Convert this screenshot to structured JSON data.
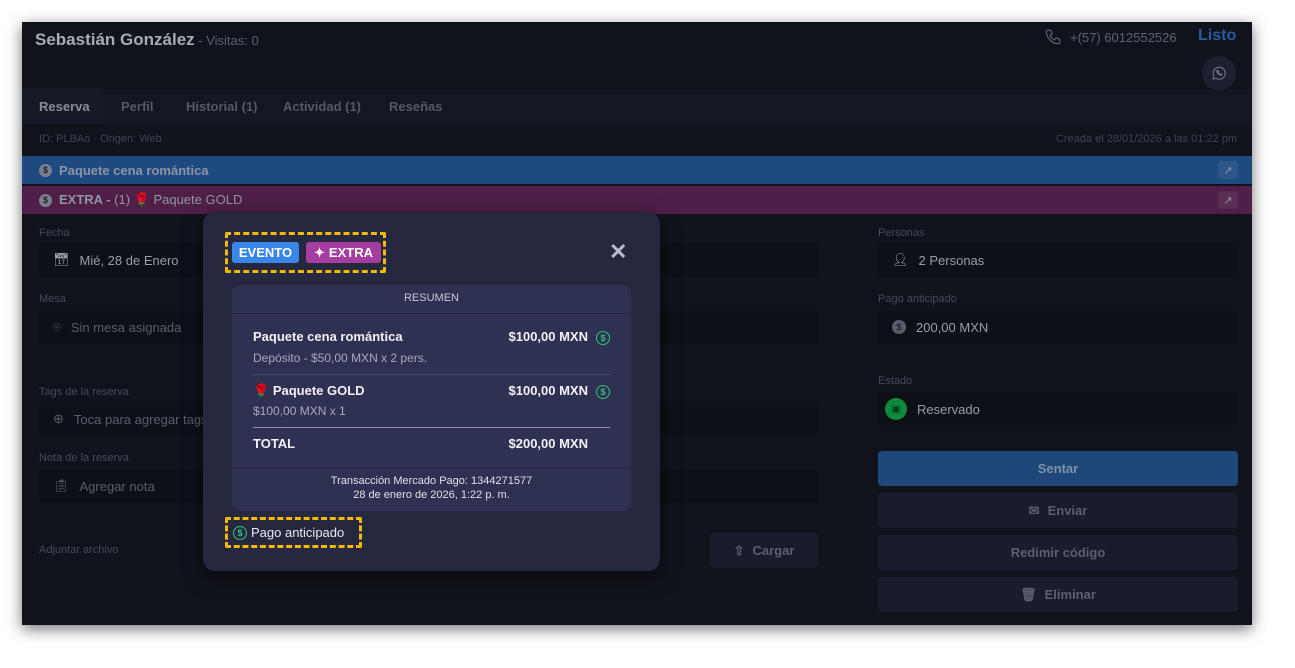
{
  "header": {
    "name": "Sebastián González",
    "visits": " - Visitas: 0",
    "phone": "+(57) 6012552526",
    "done": "Listo"
  },
  "tabs": [
    {
      "label": "Reserva",
      "active": true
    },
    {
      "label": "Perfil"
    },
    {
      "label": "Historial (1)"
    },
    {
      "label": "Actividad (1)"
    },
    {
      "label": "Reseñas"
    }
  ],
  "info": {
    "id_origin": "ID: PLBAo · Origen: Web",
    "created": "Creada el 28/01/2026 a las 01:22 pm"
  },
  "banners": [
    {
      "label": "Paquete cena romántica",
      "color": "#1e4a80"
    },
    {
      "prefix": "EXTRA -",
      "label": " (1) 🌹 Paquete GOLD",
      "color": "#4f1f4a"
    }
  ],
  "form": {
    "fecha": {
      "label": "Fecha",
      "value": "Mié, 28 de Enero"
    },
    "mesa": {
      "label": "Mesa",
      "placeholder": "Sin mesa asignada"
    },
    "tags": {
      "label": "Tags de la reserva",
      "placeholder": "Toca para agregar tags"
    },
    "nota": {
      "label": "Nota de la reserva",
      "placeholder": "Agregar nota"
    },
    "adjuntar": {
      "label": "Adjuntar archivo",
      "button": "Cargar"
    },
    "personas": {
      "label": "Personas",
      "value": "2 Personas"
    },
    "pago": {
      "label": "Pago anticipado",
      "value": "200,00 MXN"
    },
    "estado": {
      "label": "Estado",
      "value": "Reservado"
    }
  },
  "actions": {
    "sentar": "Sentar",
    "enviar": "Enviar",
    "redimir": "Redimir código",
    "eliminar": "Eliminar"
  },
  "modal": {
    "badges": [
      {
        "label": "EVENTO",
        "color": "#3a86e8"
      },
      {
        "label": "EXTRA",
        "color": "#a53ea0"
      }
    ],
    "summary_title": "RESUMEN",
    "items": [
      {
        "name": "Paquete cena romántica",
        "amount": "$100,00 MXN",
        "detail": "Depósito - $50,00 MXN x 2 pers."
      },
      {
        "name": "Paquete GOLD",
        "amount": "$100,00 MXN",
        "detail": "$100,00 MXN x 1"
      }
    ],
    "total_label": "TOTAL",
    "total": "$200,00 MXN",
    "transaction": "Transacción Mercado Pago: 1344271577",
    "transaction_date": "28 de enero de 2026, 1:22 p. m.",
    "payment_tag": "Pago anticipado"
  }
}
